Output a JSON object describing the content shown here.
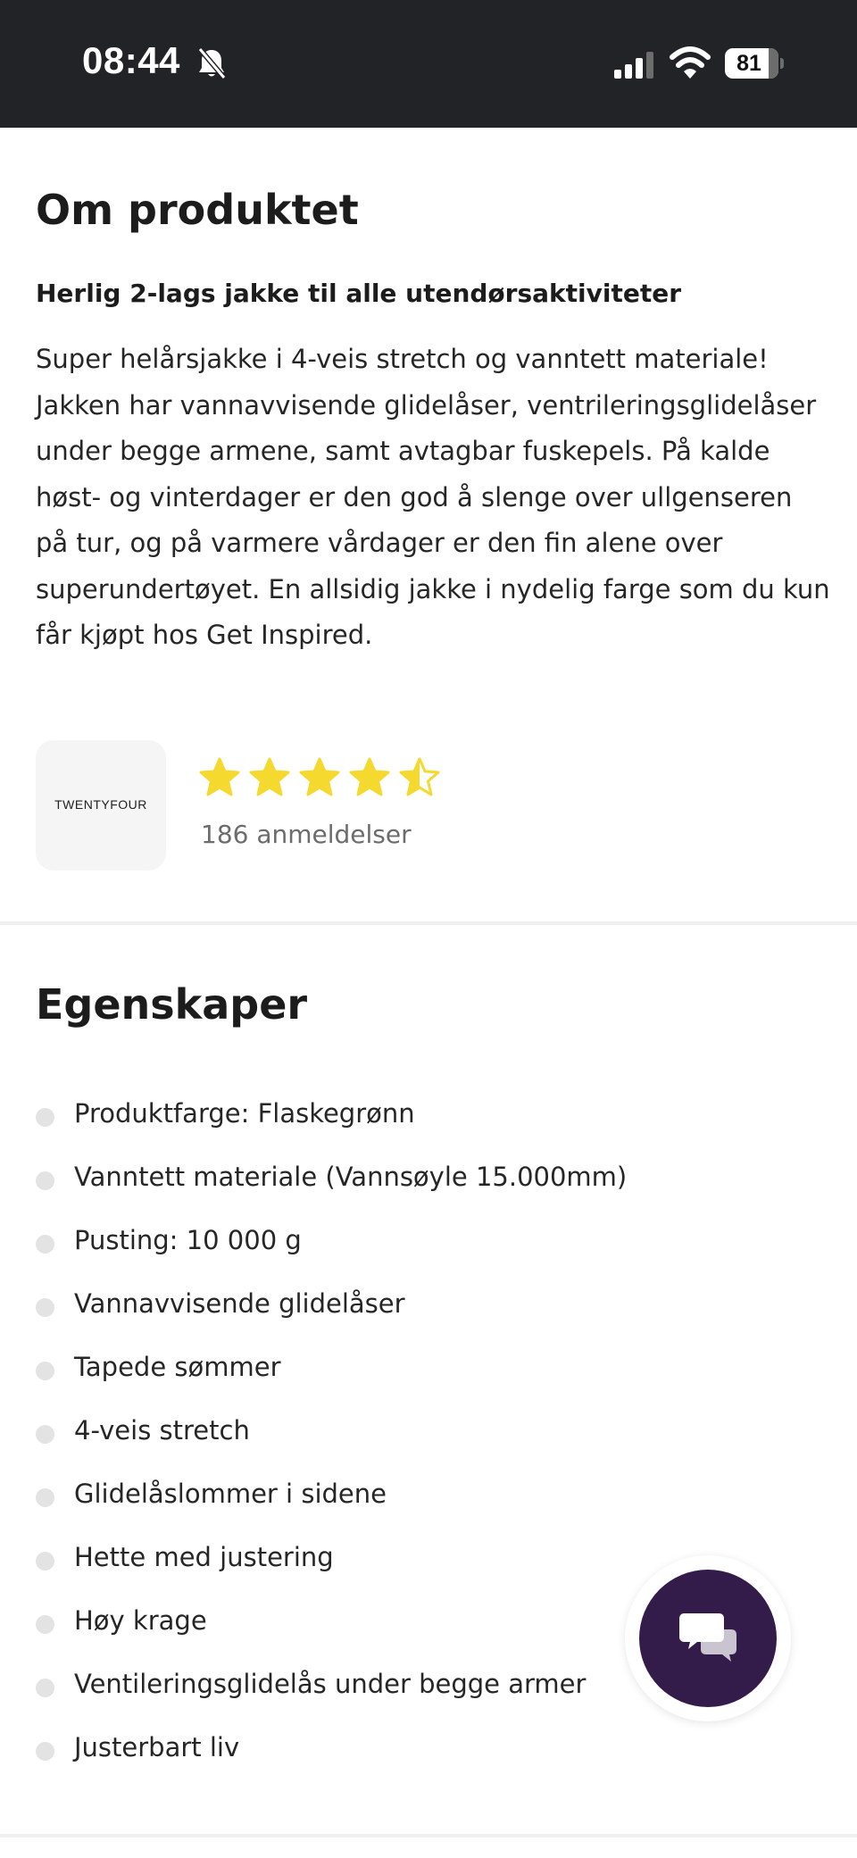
{
  "status_bar": {
    "time": "08:44",
    "battery_level": "81",
    "icons": [
      "bell-slash-icon",
      "cellular-signal-icon",
      "wifi-icon",
      "battery-icon"
    ]
  },
  "about": {
    "title": "Om produktet",
    "subheading": "Herlig 2-lags jakke til alle utendørsaktiviteter",
    "description": "Super helårsjakke i 4-veis stretch og vanntett materiale! Jakken har vannavvisende glidelåser, ventrileringsglidelåser under begge armene, samt avtagbar fuskepels. På kalde høst- og vinterdager er den god å slenge over ullgenseren på tur, og på varmere vårdager er den fin alene over superundertøyet. En allsidig jakke i nydelig farge som du kun får kjøpt hos Get Inspired."
  },
  "brand": {
    "logo_text": "TWENTYFOUR",
    "rating": 4.5,
    "rating_max": 5,
    "review_count": "186 anmeldelser"
  },
  "features": {
    "title": "Egenskaper",
    "items": [
      "Produktfarge: Flaskegrønn",
      "Vanntett materiale (Vannsøyle 15.000mm)",
      "Pusting: 10 000 g",
      "Vannavvisende glidelåser",
      "Tapede sømmer",
      "4-veis stretch",
      "Glidelåslommer i sidene",
      "Hette med justering",
      "Høy krage",
      "Ventileringsglidelås under begge armer",
      "Justerbart liv"
    ]
  },
  "chat": {
    "icon": "chat-bubbles-icon"
  },
  "colors": {
    "status_bar_bg": "#222327",
    "star_fill": "#f6d92e",
    "chat_button_bg": "#341c4a",
    "divider": "#f0f0f2",
    "bullet": "#e3e3e3"
  }
}
